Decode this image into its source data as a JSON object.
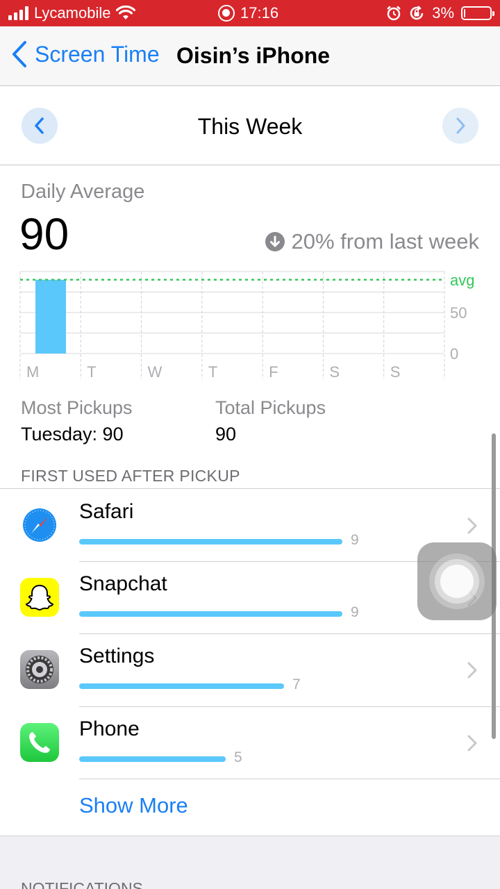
{
  "status_bar": {
    "carrier": "Lycamobile",
    "time": "17:16",
    "battery": "3%",
    "battery_level": 0.03,
    "icons": [
      "signal-icon",
      "wifi-icon",
      "screen-record-icon",
      "alarm-icon",
      "rotation-lock-icon",
      "battery-icon"
    ]
  },
  "nav": {
    "back_label": "Screen Time",
    "title": "Oisin’s iPhone"
  },
  "week": {
    "label": "This Week"
  },
  "summary": {
    "daily_average_label": "Daily Average",
    "daily_average_value": "90",
    "change_text": "20% from last week"
  },
  "chart_data": {
    "type": "bar",
    "categories": [
      "M",
      "T",
      "W",
      "T",
      "F",
      "S",
      "S"
    ],
    "values": [
      90,
      0,
      0,
      0,
      0,
      0,
      0
    ],
    "avg_value": 90,
    "avg_label": "avg",
    "ytick_labels": [
      "50",
      "0"
    ],
    "yticks": [
      50,
      0
    ],
    "ylim": [
      0,
      100
    ],
    "bar_color": "#5ac8fa",
    "avg_color": "#34c759"
  },
  "stats": {
    "most_pickups_label": "Most Pickups",
    "most_pickups_value": "Tuesday: 90",
    "total_pickups_label": "Total Pickups",
    "total_pickups_value": "90"
  },
  "first_used": {
    "header": "FIRST USED AFTER PICKUP",
    "apps": [
      {
        "name": "Safari",
        "count": "9",
        "value": 9,
        "icon": "safari-icon"
      },
      {
        "name": "Snapchat",
        "count": "9",
        "value": 9,
        "icon": "snapchat-icon"
      },
      {
        "name": "Settings",
        "count": "7",
        "value": 7,
        "icon": "settings-icon"
      },
      {
        "name": "Phone",
        "count": "5",
        "value": 5,
        "icon": "phone-icon"
      }
    ],
    "show_more": "Show More"
  },
  "notifications": {
    "header": "NOTIFICATIONS"
  }
}
